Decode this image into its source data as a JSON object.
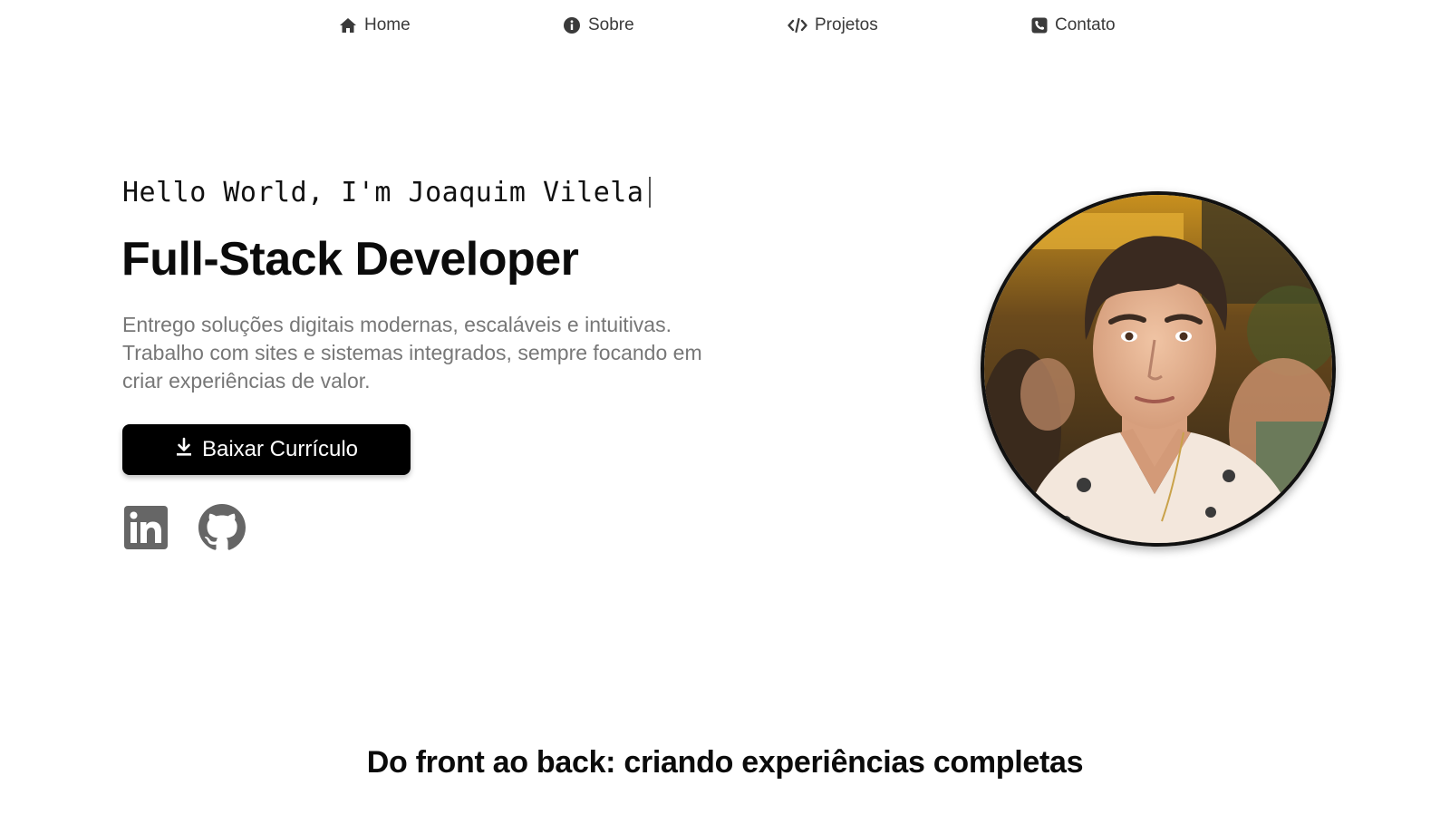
{
  "nav": {
    "items": [
      {
        "label": "Home",
        "icon": "home-icon"
      },
      {
        "label": "Sobre",
        "icon": "info-icon"
      },
      {
        "label": "Projetos",
        "icon": "code-icon"
      },
      {
        "label": "Contato",
        "icon": "phone-icon"
      }
    ]
  },
  "hero": {
    "greeting": "Hello World, I'm Joaquim Vilela",
    "title": "Full-Stack Developer",
    "description_lines": [
      "Entrego soluções digitais modernas, escaláveis e intuitivas.",
      "Trabalho com sites e sistemas integrados, sempre focando em",
      "criar experiências de valor."
    ],
    "cv_button": {
      "label": "Baixar Currículo",
      "icon": "download-icon"
    },
    "social": [
      {
        "name": "linkedin-icon"
      },
      {
        "name": "github-icon"
      }
    ]
  },
  "section": {
    "heading": "Do front ao back: criando experiências completas"
  },
  "colors": {
    "text_dark": "#0b0b0b",
    "text_muted": "#777777",
    "nav_text": "#3a3a3a",
    "button_bg": "#000000",
    "button_text": "#ffffff",
    "social_icon": "#666666"
  }
}
